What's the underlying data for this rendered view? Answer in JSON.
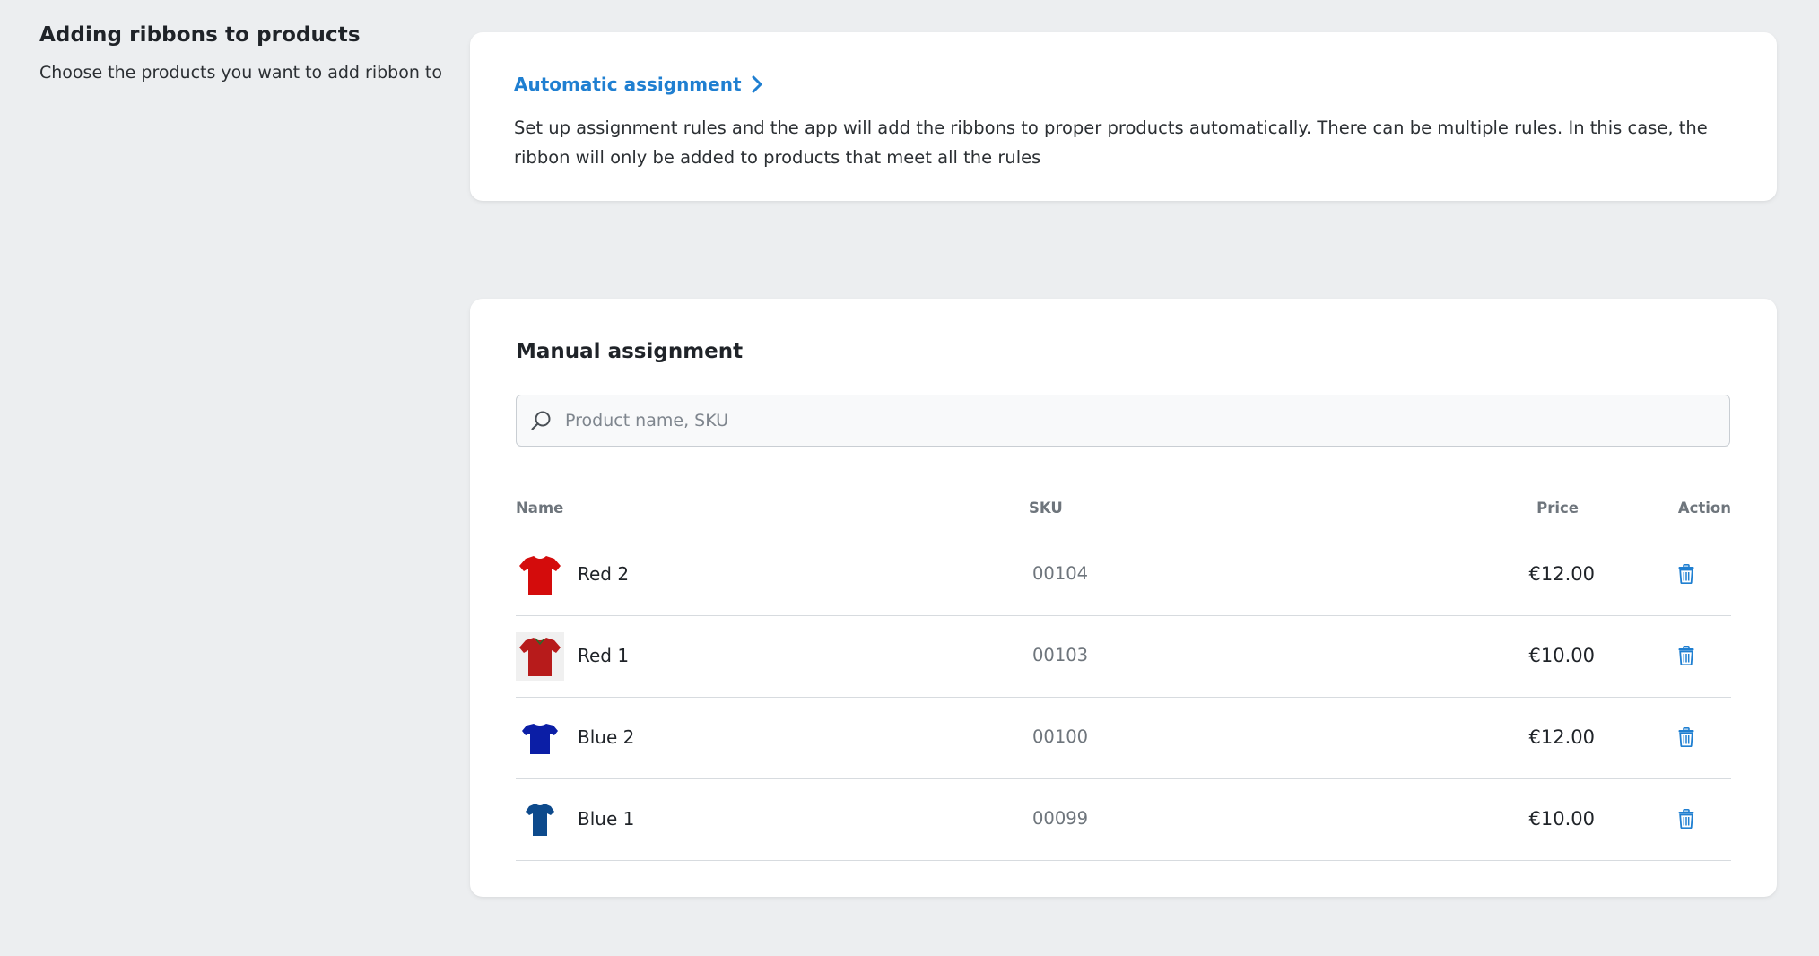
{
  "intro": {
    "title": "Adding ribbons to products",
    "description": "Choose the products you want to add ribbon to"
  },
  "automatic": {
    "link_label": "Automatic assignment",
    "description": "Set up assignment rules and the app will add the ribbons to proper products automatically. There can be multiple rules. In this case, the ribbon will only be added to products that meet all the rules"
  },
  "manual": {
    "title": "Manual assignment",
    "search": {
      "placeholder": "Product name, SKU",
      "value": ""
    },
    "columns": {
      "name": "Name",
      "sku": "SKU",
      "price": "Price",
      "action": "Action"
    },
    "products": [
      {
        "name": "Red 2",
        "sku": "00104",
        "price": "€12.00",
        "color": "#d40c0c"
      },
      {
        "name": "Red 1",
        "sku": "00103",
        "price": "€10.00",
        "color": "#b71b1b"
      },
      {
        "name": "Blue 2",
        "sku": "00100",
        "price": "€12.00",
        "color": "#0b1ea6"
      },
      {
        "name": "Blue 1",
        "sku": "00099",
        "price": "€10.00",
        "color": "#0d4a8c"
      }
    ]
  },
  "colors": {
    "accent": "#1f7fd1",
    "background": "#eceef0",
    "card": "#ffffff"
  },
  "icons": {
    "chevron": "chevron-right-icon",
    "search": "search-icon",
    "delete": "trash-icon",
    "product": "tshirt-icon"
  }
}
